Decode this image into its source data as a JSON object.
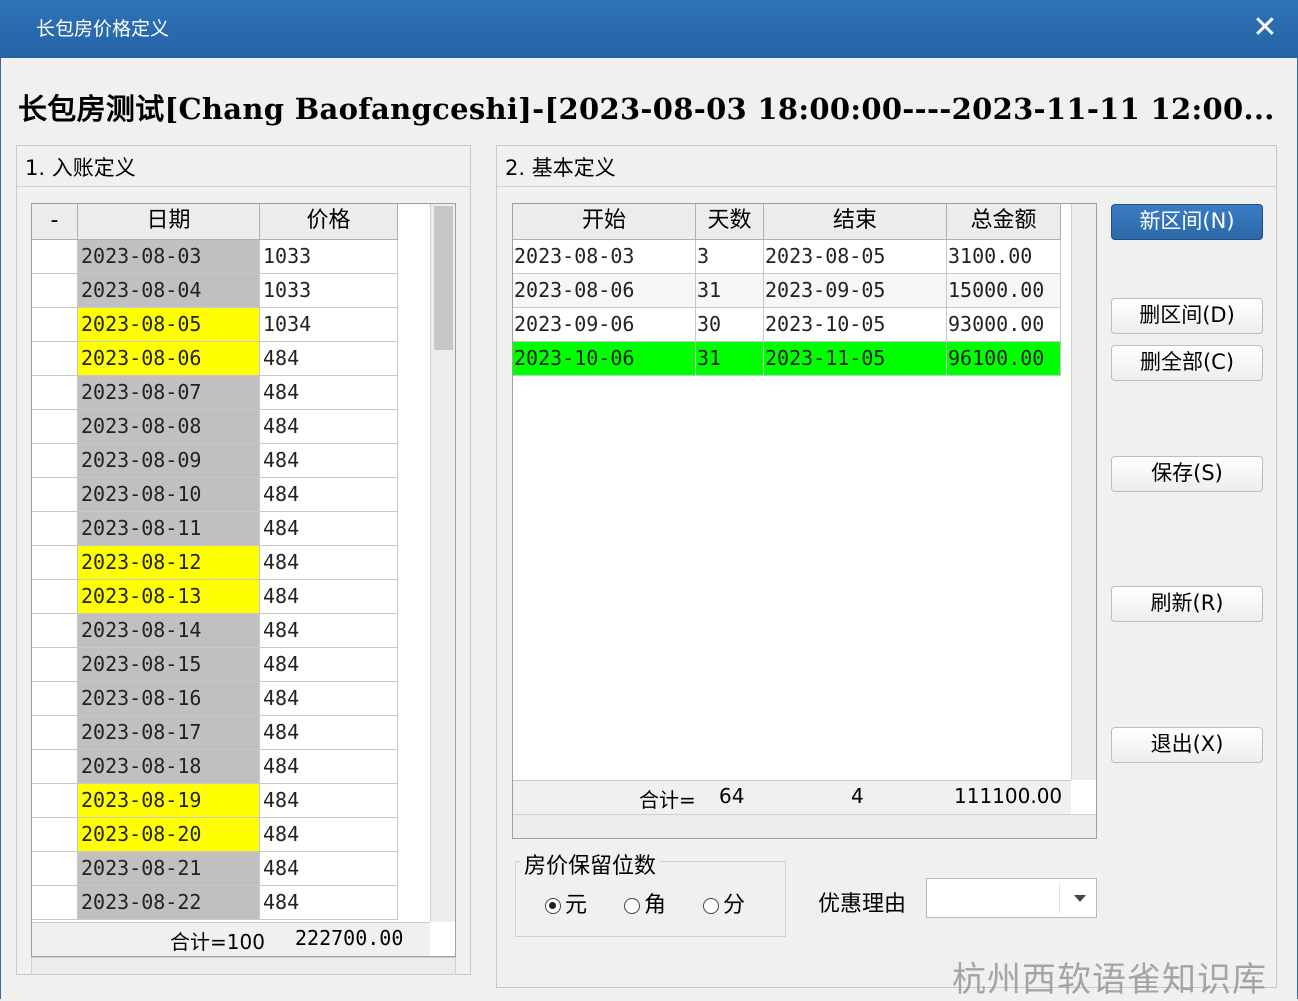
{
  "window": {
    "title": "长包房价格定义",
    "close_glyph": "✕"
  },
  "header": {
    "text": "长包房测试[Chang Baofangceshi]-[2023-08-03 18:00:00----2023-11-11 12:00..."
  },
  "colors": {
    "title_bar": "#2b6cb0",
    "highlight_yellow": "#ffff00",
    "highlight_green": "#00ff00",
    "gray_cell": "#c0c0c0",
    "primary_button": "#2b6cb0"
  },
  "left_panel": {
    "title": "1. 入账定义",
    "columns": [
      "-",
      "日期",
      "价格"
    ],
    "rows": [
      {
        "date": "2023-08-03",
        "price": "1033",
        "hl": "gray"
      },
      {
        "date": "2023-08-04",
        "price": "1033",
        "hl": "gray"
      },
      {
        "date": "2023-08-05",
        "price": "1034",
        "hl": "yellow"
      },
      {
        "date": "2023-08-06",
        "price": "484",
        "hl": "yellow"
      },
      {
        "date": "2023-08-07",
        "price": "484",
        "hl": "gray"
      },
      {
        "date": "2023-08-08",
        "price": "484",
        "hl": "gray"
      },
      {
        "date": "2023-08-09",
        "price": "484",
        "hl": "gray"
      },
      {
        "date": "2023-08-10",
        "price": "484",
        "hl": "gray"
      },
      {
        "date": "2023-08-11",
        "price": "484",
        "hl": "gray"
      },
      {
        "date": "2023-08-12",
        "price": "484",
        "hl": "yellow"
      },
      {
        "date": "2023-08-13",
        "price": "484",
        "hl": "yellow"
      },
      {
        "date": "2023-08-14",
        "price": "484",
        "hl": "gray"
      },
      {
        "date": "2023-08-15",
        "price": "484",
        "hl": "gray"
      },
      {
        "date": "2023-08-16",
        "price": "484",
        "hl": "gray"
      },
      {
        "date": "2023-08-17",
        "price": "484",
        "hl": "gray"
      },
      {
        "date": "2023-08-18",
        "price": "484",
        "hl": "gray"
      },
      {
        "date": "2023-08-19",
        "price": "484",
        "hl": "yellow"
      },
      {
        "date": "2023-08-20",
        "price": "484",
        "hl": "yellow"
      },
      {
        "date": "2023-08-21",
        "price": "484",
        "hl": "gray"
      },
      {
        "date": "2023-08-22",
        "price": "484",
        "hl": "gray"
      }
    ],
    "footer_count": "合计=100",
    "footer_total": "222700.00"
  },
  "right_panel": {
    "title": "2. 基本定义",
    "columns": [
      "开始",
      "天数",
      "结束",
      "总金额"
    ],
    "rows": [
      {
        "start": "2023-08-03",
        "days": "3",
        "end": "2023-08-05",
        "total": "3100.00",
        "hl": "none"
      },
      {
        "start": "2023-08-06",
        "days": "31",
        "end": "2023-09-05",
        "total": "15000.00",
        "hl": "none"
      },
      {
        "start": "2023-09-06",
        "days": "30",
        "end": "2023-10-05",
        "total": "93000.00",
        "hl": "none"
      },
      {
        "start": "2023-10-06",
        "days": "31",
        "end": "2023-11-05",
        "total": "96100.00",
        "hl": "green"
      }
    ],
    "footer": {
      "label": "合计=",
      "days": "64",
      "count": "4",
      "total": "111100.00"
    }
  },
  "buttons": {
    "new_interval": "新区间(N)",
    "delete_interval": "删区间(D)",
    "delete_all": "删全部(C)",
    "save": "保存(S)",
    "refresh": "刷新(R)",
    "exit": "退出(X)"
  },
  "price_precision": {
    "title": "房价保留位数",
    "options": [
      {
        "label": "元",
        "selected": true
      },
      {
        "label": "角",
        "selected": false
      },
      {
        "label": "分",
        "selected": false
      }
    ]
  },
  "discount": {
    "label": "优惠理由",
    "value": ""
  },
  "watermark": "杭州西软语雀知识库"
}
